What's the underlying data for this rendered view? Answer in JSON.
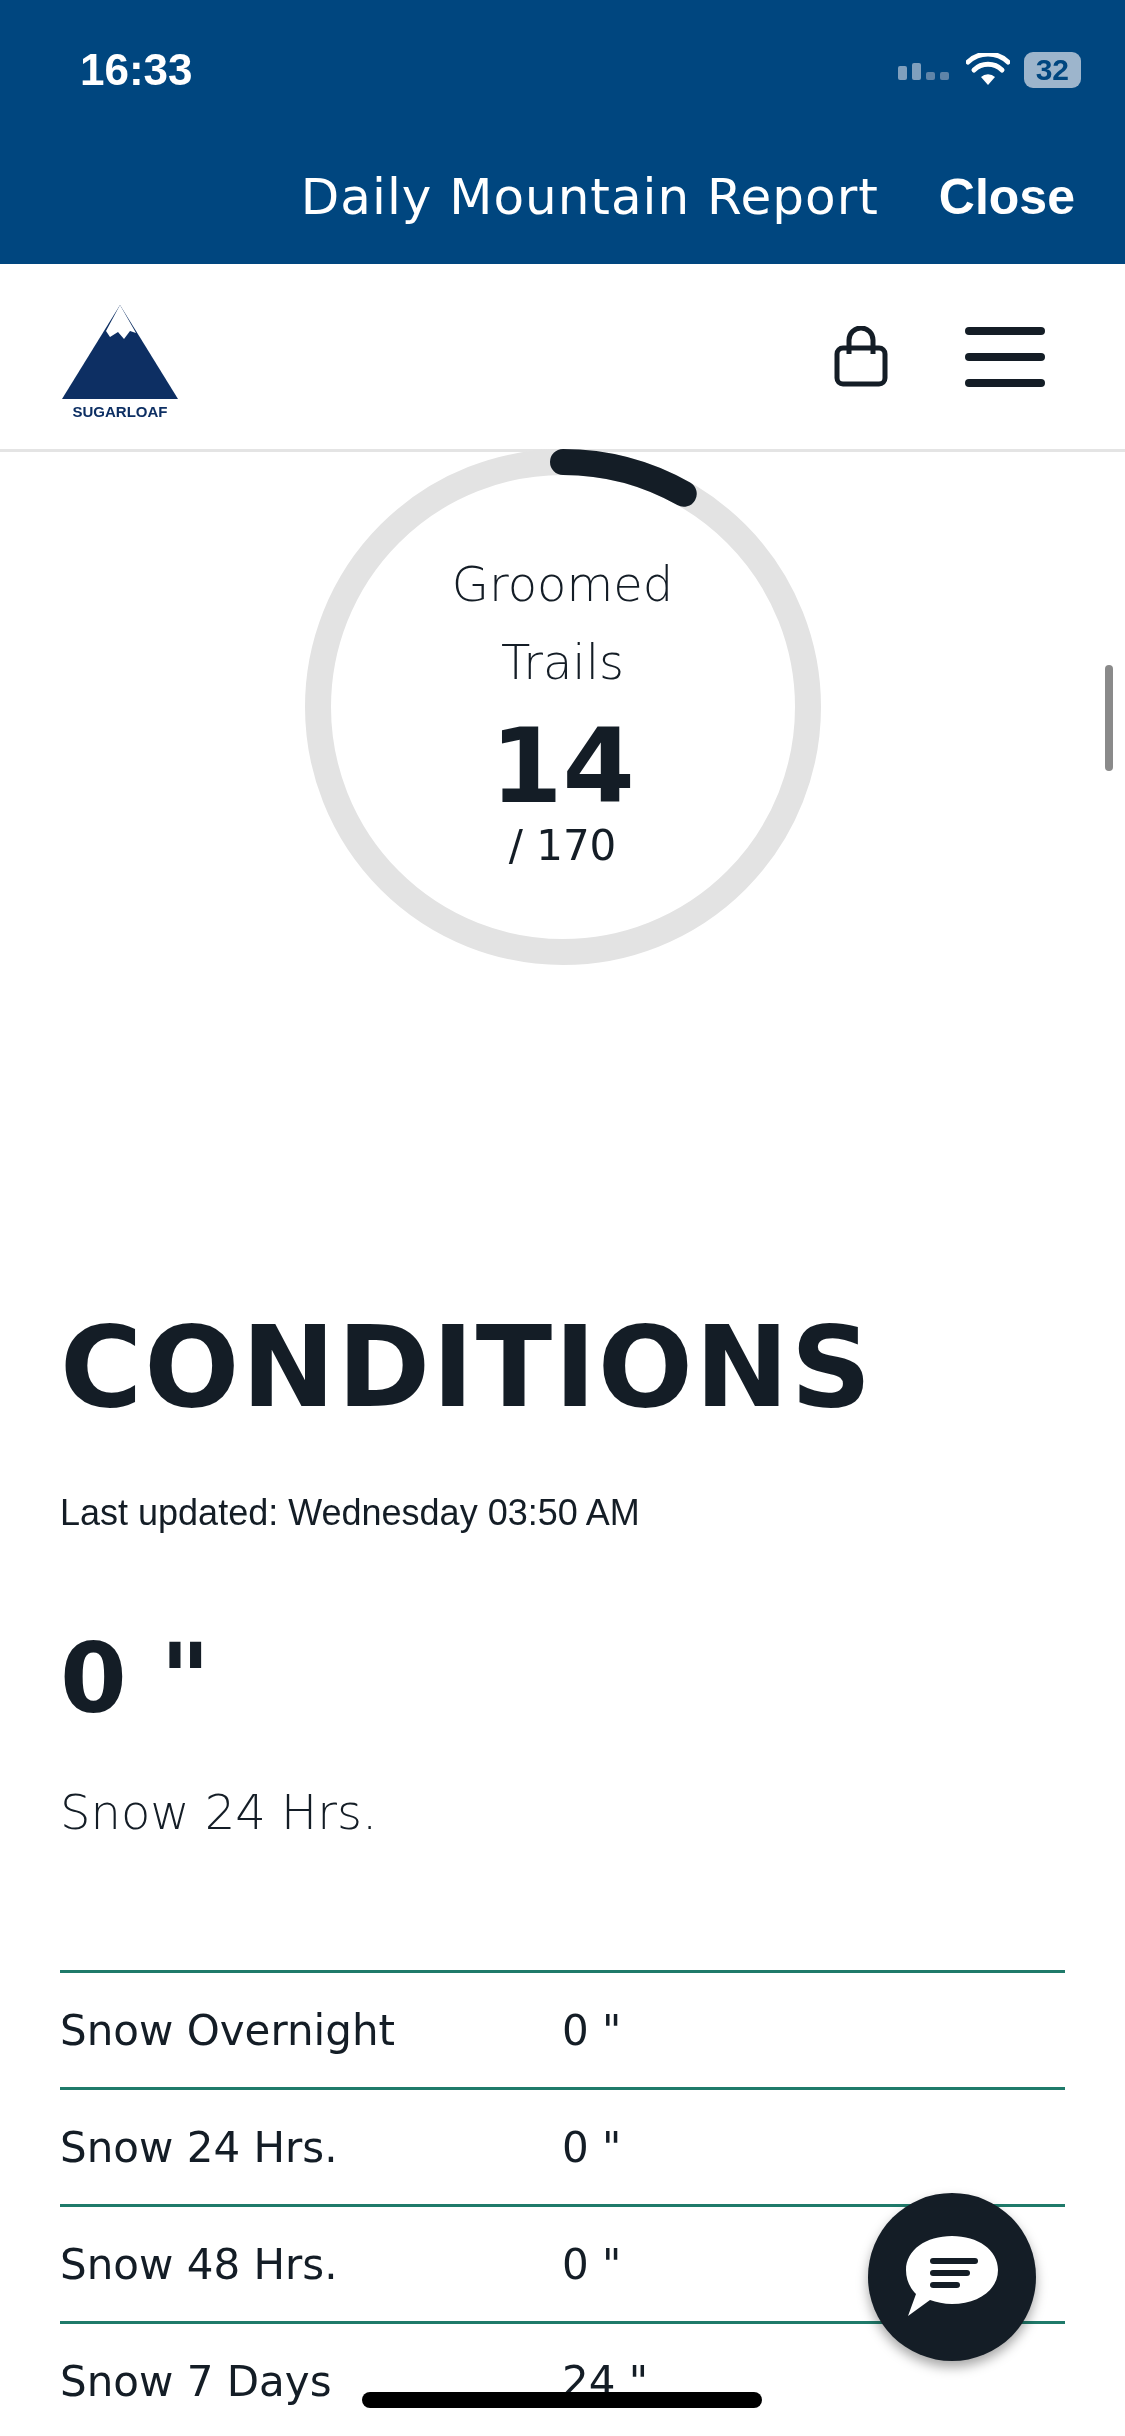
{
  "status_bar": {
    "time": "16:33",
    "battery": "32"
  },
  "header": {
    "title": "Daily Mountain Report",
    "close": "Close"
  },
  "brand": {
    "name": "SUGARLOAF"
  },
  "groomed": {
    "label": "Groomed Trails",
    "value": "14",
    "total": "/ 170"
  },
  "conditions": {
    "heading": "CONDITIONS",
    "updated": "Last updated: Wednesday 03:50 AM",
    "snow_value": "0 \"",
    "snow_label": "Snow 24 Hrs."
  },
  "table": {
    "rows": [
      {
        "label": "Snow Overnight",
        "value": "0 \""
      },
      {
        "label": "Snow 24 Hrs.",
        "value": "0 \""
      },
      {
        "label": "Snow 48 Hrs.",
        "value": "0 \""
      },
      {
        "label": "Snow 7 Days",
        "value": "24 \""
      }
    ]
  }
}
